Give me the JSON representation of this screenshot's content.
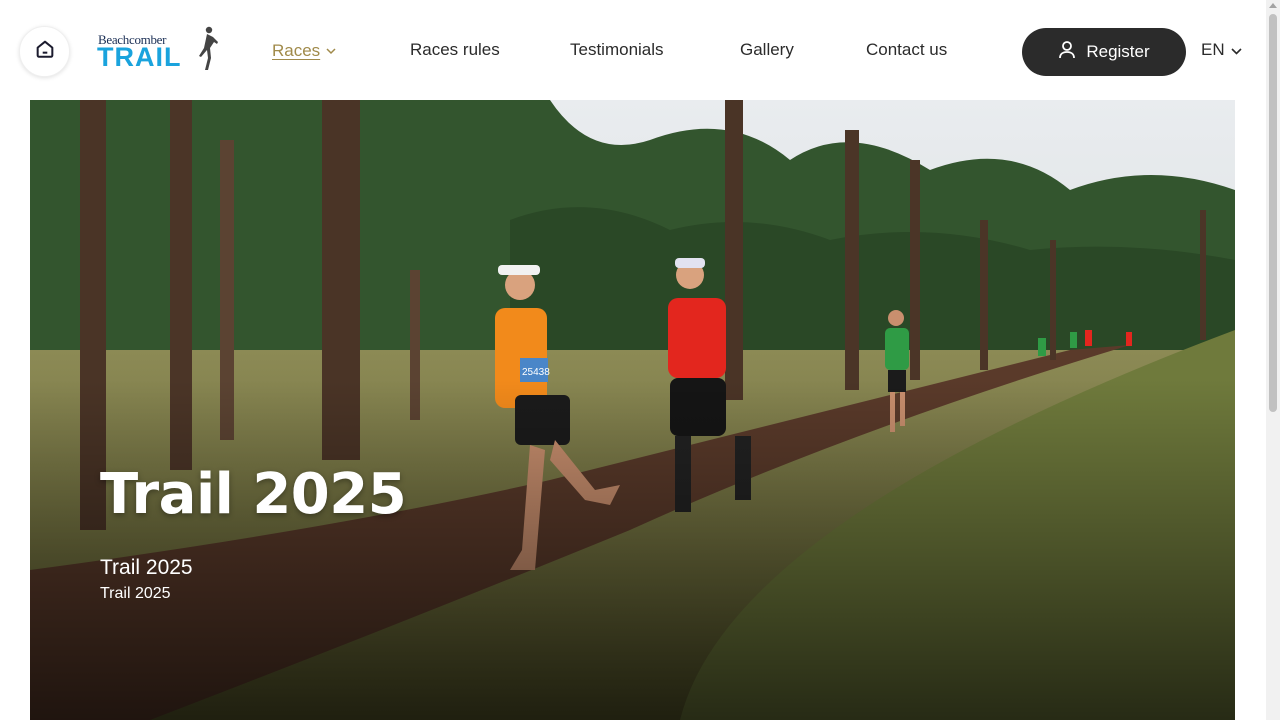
{
  "header": {
    "logo": {
      "top_text": "Beachcomber",
      "bottom_text": "TRAIL"
    },
    "nav": [
      {
        "label": "Races",
        "active": true
      },
      {
        "label": "Races rules"
      },
      {
        "label": "Testimonials"
      },
      {
        "label": "Gallery"
      },
      {
        "label": "Contact us"
      }
    ],
    "register_label": "Register",
    "language": "EN",
    "icons": {
      "home": "home-icon",
      "user": "user-icon",
      "chevron": "chevron-down-icon"
    }
  },
  "hero": {
    "title": "Trail 2025",
    "subtitle": "Trail 2025",
    "caption": "Trail 2025",
    "bib_number": "25438"
  },
  "colors": {
    "accent_gold": "#a08a4a",
    "brand_blue": "#1aa3dd",
    "dark": "#2b2b2b"
  }
}
